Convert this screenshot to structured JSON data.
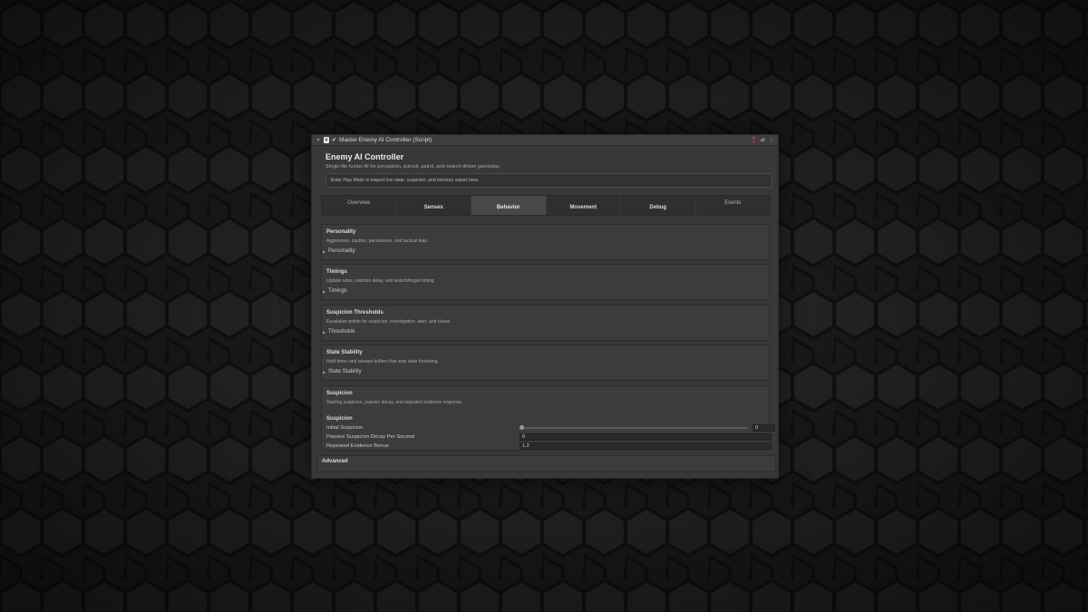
{
  "titlebar": {
    "title": "Master Enemy AI Controller (Script)",
    "script_icon": "script-icon",
    "help_icon": "help-icon",
    "preset_icon": "preset-icon",
    "menu_icon": "kebab-menu-icon"
  },
  "header": {
    "title": "Enemy AI Controller",
    "subtitle": "Single-file hunter AI for perception, pursuit, patrol, and search-driven gameplay.",
    "info": "Enter Play Mode to inspect live state, suspicion, and memory values here."
  },
  "tabs": [
    {
      "label": "Overview",
      "active": false
    },
    {
      "label": "Senses",
      "active": false
    },
    {
      "label": "Behavior",
      "active": true
    },
    {
      "label": "Movement",
      "active": false
    },
    {
      "label": "Debug",
      "active": false
    },
    {
      "label": "Events",
      "active": false
    }
  ],
  "sections": {
    "personality": {
      "title": "Personality",
      "desc": "Aggression, caution, persistence, and tactical bias.",
      "fold": "Personality"
    },
    "timings": {
      "title": "Timings",
      "desc": "Update rates, reaction delay, and search/forget timing.",
      "fold": "Timings"
    },
    "thresholds": {
      "title": "Suspicion Thresholds",
      "desc": "Escalation points for suspicion, investigation, alert, and chase.",
      "fold": "Thresholds"
    },
    "stability": {
      "title": "State Stability",
      "desc": "Hold times and release buffers that stop state thrashing.",
      "fold": "State Stability"
    },
    "suspicion": {
      "title": "Suspicion",
      "desc": "Starting suspicion, passive decay, and repeated evidence response.",
      "sub_header": "Suspicion",
      "initial_label": "Initial Suspicion",
      "initial_value": "0",
      "initial_fraction": 0,
      "decay_label": "Passive Suspicion Decay Per Second",
      "decay_value": "6",
      "bonus_label": "Repeated Evidence Bonus",
      "bonus_value": "1.2"
    },
    "advanced": {
      "title": "Advanced"
    }
  }
}
